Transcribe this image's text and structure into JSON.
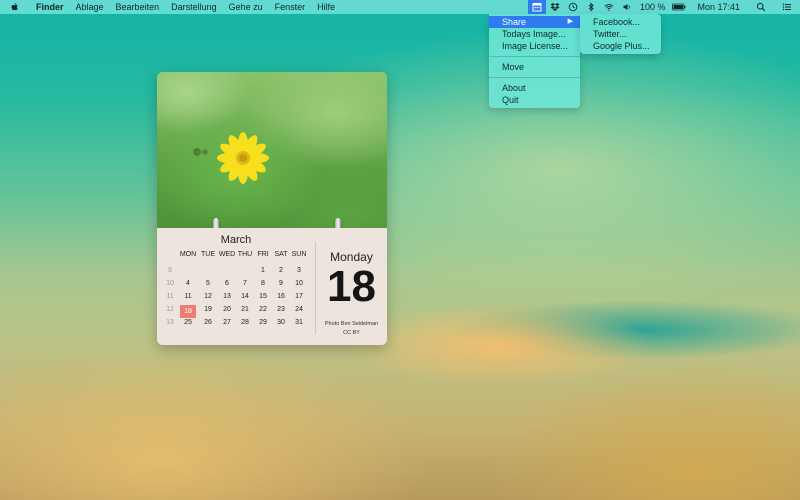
{
  "menubar": {
    "app_name": "Finder",
    "items": [
      "Ablage",
      "Bearbeiten",
      "Darstellung",
      "Gehe zu",
      "Fenster",
      "Hilfe"
    ],
    "battery": "100 %",
    "clock": "Mon 17:41"
  },
  "icons": [
    "apple-icon",
    "calendar-status-icon",
    "dropbox-icon",
    "time-machine-icon",
    "bluetooth-icon",
    "wifi-icon",
    "volume-icon",
    "battery-icon",
    "spotlight-icon",
    "notification-center-icon"
  ],
  "colors": {
    "highlight": "#2e7cf0",
    "today": "#f07c72"
  },
  "menu": {
    "items": [
      {
        "label": "Share",
        "highlighted": true
      },
      {
        "label": "Todays Image..."
      },
      {
        "label": "Image License..."
      },
      {
        "label": "Move"
      },
      {
        "label": "About"
      },
      {
        "label": "Quit"
      }
    ],
    "submenu_arrow": "▶"
  },
  "submenu": {
    "items": [
      "Facebook...",
      "Twitter...",
      "Google Plus..."
    ]
  },
  "calendar": {
    "month": "March",
    "weekdays": [
      "MON",
      "TUE",
      "WED",
      "THU",
      "FRI",
      "SAT",
      "SUN"
    ],
    "weeks": [
      {
        "num": "9",
        "days": [
          "",
          "",
          "",
          "",
          "1",
          "2",
          "3"
        ]
      },
      {
        "num": "10",
        "days": [
          "4",
          "5",
          "6",
          "7",
          "8",
          "9",
          "10"
        ]
      },
      {
        "num": "11",
        "days": [
          "11",
          "12",
          "13",
          "14",
          "15",
          "16",
          "17"
        ]
      },
      {
        "num": "12",
        "days": [
          "18",
          "19",
          "20",
          "21",
          "22",
          "23",
          "24"
        ]
      },
      {
        "num": "13",
        "days": [
          "25",
          "26",
          "27",
          "28",
          "29",
          "30",
          "31"
        ]
      }
    ],
    "today": "18",
    "weekday_name": "Monday",
    "big_day": "18",
    "photo_credit": "Photo Ben Seidelman",
    "license": "CC BY"
  }
}
